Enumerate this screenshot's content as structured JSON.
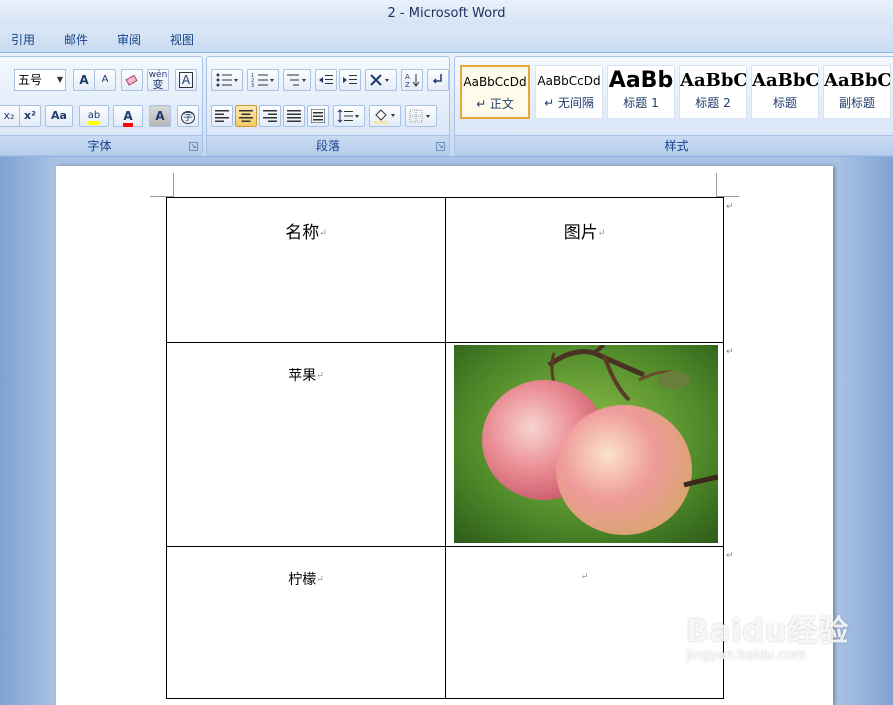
{
  "window": {
    "title": "2 - Microsoft Word"
  },
  "tabs": [
    "引用",
    "邮件",
    "审阅",
    "视图"
  ],
  "ribbon": {
    "font_group": {
      "label": "字体",
      "size_value": "五号",
      "grow_label": "A",
      "shrink_label": "A",
      "phonetic_label": "wén",
      "phonetic_char": "变",
      "border_label": "A",
      "subscript_label": "x₂",
      "superscript_label": "x²",
      "case_label": "Aa",
      "highlight_label": "ab",
      "color_label": "A",
      "shade_label": "A",
      "enclose_label": "字"
    },
    "paragraph_group": {
      "label": "段落"
    },
    "styles_group": {
      "label": "样式",
      "tiles": [
        {
          "sample": "AaBbCcDd",
          "name": "↵ 正文"
        },
        {
          "sample": "AaBbCcDd",
          "name": "↵ 无间隔"
        },
        {
          "sample": "AaBb",
          "name": "标题 1"
        },
        {
          "sample": "AaBbC",
          "name": "标题 2"
        },
        {
          "sample": "AaBbC",
          "name": "标题"
        },
        {
          "sample": "AaBbC",
          "name": "副标题"
        }
      ]
    },
    "accent_highlight": "#ffff00",
    "accent_font_color": "#ff0000"
  },
  "document": {
    "table": {
      "header": [
        "名称",
        "图片"
      ],
      "rows": [
        {
          "name": "苹果",
          "picture": "apple photo"
        },
        {
          "name": "柠檬",
          "picture": ""
        }
      ]
    },
    "cell_mark": "↵"
  },
  "watermark": {
    "logo": "Baidu经验",
    "url": "jingyan.baidu.com"
  }
}
